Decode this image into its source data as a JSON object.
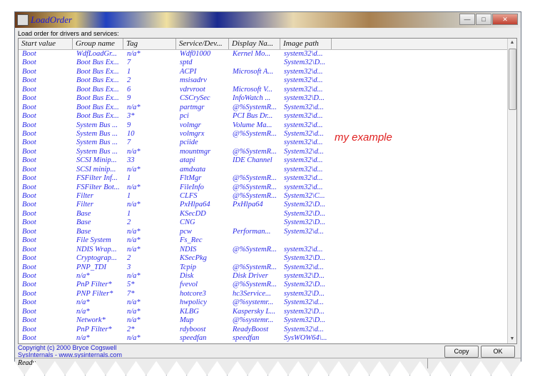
{
  "window": {
    "title": "LoadOrder",
    "controls": [
      "minimize",
      "maximize",
      "close"
    ]
  },
  "label": "Load order for drivers and services:",
  "columns": [
    "Start value",
    "Group name",
    "Tag",
    "Service/Dev...",
    "Display Na...",
    "Image path",
    ""
  ],
  "rows": [
    [
      "Boot",
      "WdfLoadGr...",
      "n/a*",
      "Wdf01000",
      "Kernel Mo...",
      "system32\\d..."
    ],
    [
      "Boot",
      "Boot Bus Ex...",
      "7",
      "sptd",
      "",
      "System32\\D..."
    ],
    [
      "Boot",
      "Boot Bus Ex...",
      "1",
      "ACPI",
      "Microsoft A...",
      "system32\\d..."
    ],
    [
      "Boot",
      "Boot Bus Ex...",
      "2",
      "msisadrv",
      "",
      "system32\\d..."
    ],
    [
      "Boot",
      "Boot Bus Ex...",
      "6",
      "vdrvroot",
      "Microsoft V...",
      "system32\\d..."
    ],
    [
      "Boot",
      "Boot Bus Ex...",
      "9",
      "CSCrySec",
      "InfoWatch ...",
      "system32\\D..."
    ],
    [
      "Boot",
      "Boot Bus Ex...",
      "n/a*",
      "partmgr",
      "@%SystemR...",
      "System32\\d..."
    ],
    [
      "Boot",
      "Boot Bus Ex...",
      "3*",
      "pci",
      "PCI Bus Dr...",
      "system32\\d..."
    ],
    [
      "Boot",
      "System Bus ...",
      "9",
      "volmgr",
      "Volume Ma...",
      "system32\\d..."
    ],
    [
      "Boot",
      "System Bus ...",
      "10",
      "volmgrx",
      "@%SystemR...",
      "System32\\d..."
    ],
    [
      "Boot",
      "System Bus ...",
      "7",
      "pciide",
      "",
      "system32\\d..."
    ],
    [
      "Boot",
      "System Bus ...",
      "n/a*",
      "mountmgr",
      "@%SystemR...",
      "System32\\d..."
    ],
    [
      "Boot",
      "SCSI Minip...",
      "33",
      "atapi",
      "IDE Channel",
      "system32\\d..."
    ],
    [
      "Boot",
      "SCSI minip...",
      "n/a*",
      "amdxata",
      "",
      "system32\\d..."
    ],
    [
      "Boot",
      "FSFilter Inf...",
      "1",
      "FltMgr",
      "@%SystemR...",
      "system32\\d..."
    ],
    [
      "Boot",
      "FSFilter Bot...",
      "n/a*",
      "FileInfo",
      "@%SystemR...",
      "system32\\d..."
    ],
    [
      "Boot",
      "Filter",
      "1",
      "CLFS",
      "@%SystemR...",
      "System32\\C..."
    ],
    [
      "Boot",
      "Filter",
      "n/a*",
      "PxHlpa64",
      "PxHlpa64",
      "System32\\D..."
    ],
    [
      "Boot",
      "Base",
      "1",
      "KSecDD",
      "",
      "System32\\D..."
    ],
    [
      "Boot",
      "Base",
      "2",
      "CNG",
      "",
      "System32\\D..."
    ],
    [
      "Boot",
      "Base",
      "n/a*",
      "pcw",
      "Performan...",
      "System32\\d..."
    ],
    [
      "Boot",
      "File System",
      "n/a*",
      "Fs_Rec",
      "",
      ""
    ],
    [
      "Boot",
      "NDIS Wrap...",
      "n/a*",
      "NDIS",
      "@%SystemR...",
      "system32\\d..."
    ],
    [
      "Boot",
      "Cryptograp...",
      "2",
      "KSecPkg",
      "",
      "System32\\D..."
    ],
    [
      "Boot",
      "PNP_TDI",
      "3",
      "Tcpip",
      "@%SystemR...",
      "System32\\d..."
    ],
    [
      "Boot",
      "n/a*",
      "n/a*",
      "Disk",
      "Disk Driver",
      "system32\\D..."
    ],
    [
      "Boot",
      "PnP Filter*",
      "5*",
      "fvevol",
      "@%SystemR...",
      "System32\\D..."
    ],
    [
      "Boot",
      "PNP Filter*",
      "7*",
      "hotcore3",
      "hc3Service...",
      "system32\\D..."
    ],
    [
      "Boot",
      "n/a*",
      "n/a*",
      "hwpolicy",
      "@%systemr...",
      "System32\\d..."
    ],
    [
      "Boot",
      "n/a*",
      "n/a*",
      "KLBG",
      "Kaspersky L...",
      "system32\\D..."
    ],
    [
      "Boot",
      "Network*",
      "n/a*",
      "Mup",
      "@%systemr...",
      "System32\\D..."
    ],
    [
      "Boot",
      "PnP Filter*",
      "2*",
      "rdyboost",
      "ReadyBoost",
      "System32\\d..."
    ],
    [
      "Boot",
      "n/a*",
      "n/a*",
      "speedfan",
      "speedfan",
      "SysWOW64\\..."
    ]
  ],
  "annotation": "my example",
  "footer": {
    "copyright_line1": "Copyright (c) 2000 Bryce Cogswell",
    "copyright_line2": "SysInternals - www.sysinternals.com",
    "copy_button": "Copy",
    "ok_button": "OK"
  },
  "status": "Ready",
  "colors": {
    "cell_text": "#2a2ae8",
    "annotation": "#e02020",
    "copyright": "#1a1ad0"
  }
}
